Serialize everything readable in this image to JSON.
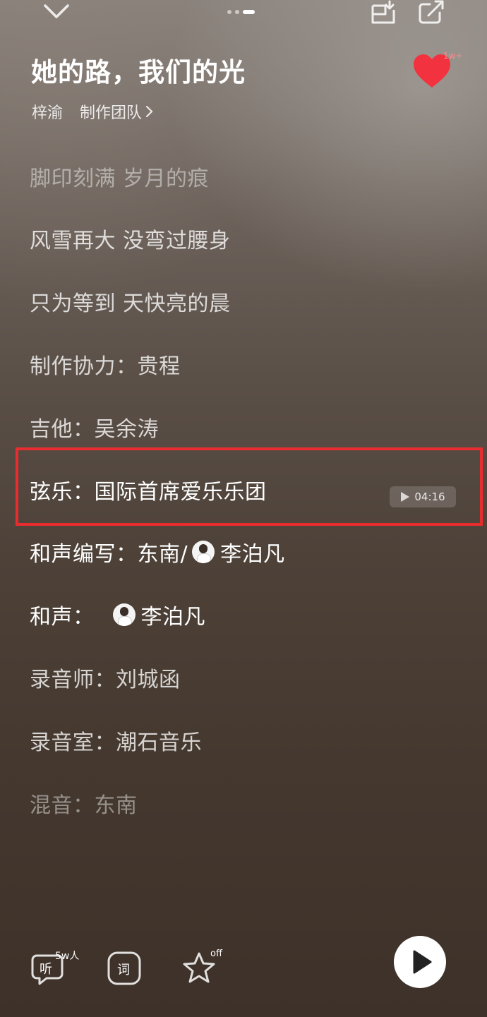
{
  "header": {
    "song_title": "她的路，我们的光",
    "artist": "梓渝",
    "team_link": "制作团队",
    "like_count": "1w+"
  },
  "lyrics": [
    {
      "text": "脚印刻满 岁月的痕"
    },
    {
      "text": "风雪再大 没弯过腰身"
    },
    {
      "text": "只为等到 天快亮的晨"
    },
    {
      "text": "制作协力：贵程"
    },
    {
      "text": "吉他：吴余涛"
    },
    {
      "text": "弦乐：国际首席爱乐乐团"
    },
    {
      "text_a": "和声编写：东南/",
      "text_b": "李泊凡"
    },
    {
      "text_a": "和声：",
      "text_b": "李泊凡"
    },
    {
      "text": "录音师：刘城函"
    },
    {
      "text": "录音室：潮石音乐"
    },
    {
      "text": "混音：东南"
    }
  ],
  "seek_time": "04:16",
  "bottom_bar": {
    "listen_label": "听",
    "listen_badge": "5w人",
    "lyrics_label": "词",
    "fav_badge": "off"
  },
  "colors": {
    "like_red": "#f2323f",
    "highlight_red": "#ea2c2f"
  },
  "icons": [
    "chevron-down-icon",
    "mini-player-icon",
    "share-icon",
    "heart-icon",
    "play-icon",
    "star-icon"
  ]
}
